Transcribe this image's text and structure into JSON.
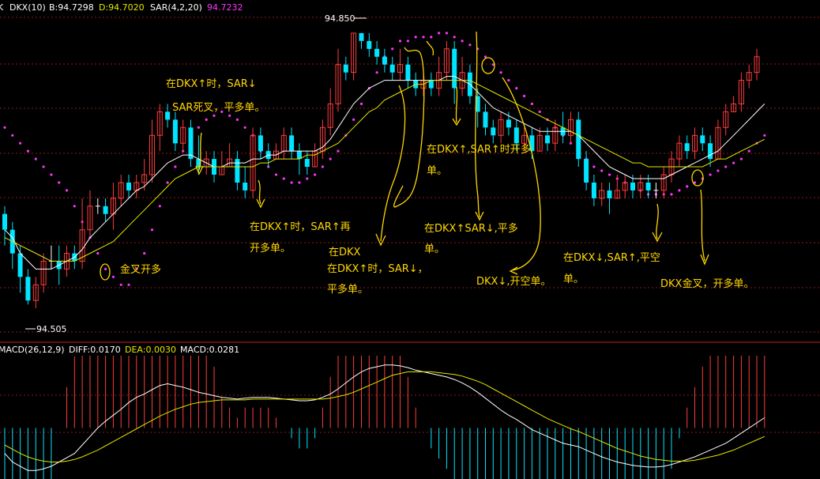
{
  "colors": {
    "background": "#000000",
    "up": "#ff3b3b",
    "down": "#00e5ff",
    "doji": "#ffffff",
    "grid": "#8b1a1a",
    "dkx": "#ffffff",
    "madkx": "#e6e600",
    "sar": "#ff33ff",
    "annotation": "#ffd700",
    "diff": "#ffffff",
    "dea": "#e6e600"
  },
  "header": {
    "prefix": "K",
    "dkx_label": "DKX(10)",
    "b_label": "B:94.7298",
    "d_label": "D:94.7020",
    "sar_label": "SAR(4,2,20)",
    "sar_value": "94.7232"
  },
  "price_marks": {
    "high": "94.850",
    "low": "94.505"
  },
  "macd_header": {
    "name": "MACD(26,12,9)",
    "diff": "DIFF:0.0170",
    "dea": "DEA:0.0030",
    "macd": "MACD:0.0281"
  },
  "annotations": {
    "a1_l1": "在DKX↑时，SAR↓",
    "a1_l2": "SAR死叉，平多单。",
    "a2": "金叉开多",
    "a3_l1": "在DKX↑时，SAR↑再",
    "a3_l2": "开多单。",
    "a4_l1": "在DKX",
    "a4_l2": "在DKX↑时，SAR↓，",
    "a4_l3": "平多单。",
    "a5_l1": "在DKX↑,SAR↑时开多",
    "a5_l2": "单。",
    "a6_l1": "在DKX↑SAR↓,平多",
    "a6_l2": "单。",
    "a7": "DKX↓,开空单。",
    "a8_l1": "在DKX↓,SAR↑,平空",
    "a8_l2": "单。",
    "a9": "DKX金叉，开多单。"
  },
  "chart_data": {
    "type": "candlestick",
    "price_range": [
      94.47,
      94.87
    ],
    "high_mark": 94.85,
    "low_mark": 94.505,
    "candles": [
      [
        94.62,
        94.6,
        94.63,
        94.58
      ],
      [
        94.6,
        94.57,
        94.61,
        94.55
      ],
      [
        94.57,
        94.54,
        94.58,
        94.52
      ],
      [
        94.54,
        94.51,
        94.55,
        94.505
      ],
      [
        94.51,
        94.53,
        94.54,
        94.5
      ],
      [
        94.53,
        94.56,
        94.57,
        94.52
      ],
      [
        94.56,
        94.56,
        94.58,
        94.55
      ],
      [
        94.56,
        94.55,
        94.58,
        94.53
      ],
      [
        94.55,
        94.57,
        94.58,
        94.54
      ],
      [
        94.57,
        94.56,
        94.58,
        94.55
      ],
      [
        94.56,
        94.6,
        94.64,
        94.55
      ],
      [
        94.6,
        94.63,
        94.65,
        94.59
      ],
      [
        94.63,
        94.63,
        94.64,
        94.62
      ],
      [
        94.63,
        94.62,
        94.64,
        94.61
      ],
      [
        94.62,
        94.64,
        94.66,
        94.6
      ],
      [
        94.64,
        94.66,
        94.67,
        94.63
      ],
      [
        94.66,
        94.65,
        94.67,
        94.64
      ],
      [
        94.65,
        94.66,
        94.67,
        94.64
      ],
      [
        94.66,
        94.67,
        94.69,
        94.65
      ],
      [
        94.67,
        94.72,
        94.74,
        94.66
      ],
      [
        94.72,
        94.75,
        94.76,
        94.7
      ],
      [
        94.75,
        94.74,
        94.76,
        94.73
      ],
      [
        94.74,
        94.71,
        94.75,
        94.7
      ],
      [
        94.71,
        94.73,
        94.74,
        94.7
      ],
      [
        94.73,
        94.69,
        94.74,
        94.68
      ],
      [
        94.69,
        94.68,
        94.72,
        94.67
      ],
      [
        94.68,
        94.69,
        94.7,
        94.67
      ],
      [
        94.69,
        94.67,
        94.7,
        94.66
      ],
      [
        94.67,
        94.68,
        94.7,
        94.67
      ],
      [
        94.68,
        94.69,
        94.71,
        94.68
      ],
      [
        94.69,
        94.66,
        94.7,
        94.65
      ],
      [
        94.66,
        94.65,
        94.68,
        94.64
      ],
      [
        94.65,
        94.72,
        94.73,
        94.64
      ],
      [
        94.72,
        94.7,
        94.73,
        94.69
      ],
      [
        94.7,
        94.69,
        94.71,
        94.68
      ],
      [
        94.69,
        94.7,
        94.71,
        94.69
      ],
      [
        94.7,
        94.72,
        94.73,
        94.69
      ],
      [
        94.72,
        94.7,
        94.73,
        94.69
      ],
      [
        94.7,
        94.69,
        94.71,
        94.67
      ],
      [
        94.69,
        94.68,
        94.7,
        94.67
      ],
      [
        94.68,
        94.7,
        94.71,
        94.68
      ],
      [
        94.7,
        94.73,
        94.74,
        94.69
      ],
      [
        94.73,
        94.76,
        94.78,
        94.72
      ],
      [
        94.76,
        94.81,
        94.83,
        94.75
      ],
      [
        94.81,
        94.8,
        94.82,
        94.79
      ],
      [
        94.8,
        94.85,
        94.85,
        94.79
      ],
      [
        94.85,
        94.84,
        94.85,
        94.83
      ],
      [
        94.84,
        94.83,
        94.85,
        94.82
      ],
      [
        94.83,
        94.82,
        94.84,
        94.81
      ],
      [
        94.82,
        94.81,
        94.83,
        94.8
      ],
      [
        94.81,
        94.8,
        94.82,
        94.79
      ],
      [
        94.8,
        94.81,
        94.83,
        94.79
      ],
      [
        94.81,
        94.79,
        94.82,
        94.78
      ],
      [
        94.79,
        94.78,
        94.8,
        94.77
      ],
      [
        94.78,
        94.79,
        94.8,
        94.77
      ],
      [
        94.79,
        94.78,
        94.8,
        94.77
      ],
      [
        94.78,
        94.8,
        94.82,
        94.77
      ],
      [
        94.8,
        94.83,
        94.84,
        94.79
      ],
      [
        94.83,
        94.78,
        94.84,
        94.76
      ],
      [
        94.78,
        94.8,
        94.82,
        94.77
      ],
      [
        94.8,
        94.77,
        94.81,
        94.76
      ],
      [
        94.77,
        94.75,
        94.78,
        94.73
      ],
      [
        94.75,
        94.73,
        94.76,
        94.72
      ],
      [
        94.73,
        94.72,
        94.74,
        94.71
      ],
      [
        94.72,
        94.74,
        94.75,
        94.71
      ],
      [
        94.74,
        94.73,
        94.75,
        94.72
      ],
      [
        94.73,
        94.71,
        94.74,
        94.7
      ],
      [
        94.71,
        94.72,
        94.73,
        94.7
      ],
      [
        94.72,
        94.7,
        94.73,
        94.69
      ],
      [
        94.7,
        94.72,
        94.73,
        94.7
      ],
      [
        94.72,
        94.71,
        94.73,
        94.7
      ],
      [
        94.71,
        94.73,
        94.74,
        94.7
      ],
      [
        94.73,
        94.72,
        94.75,
        94.71
      ],
      [
        94.72,
        94.74,
        94.75,
        94.71
      ],
      [
        94.74,
        94.69,
        94.75,
        94.68
      ],
      [
        94.69,
        94.66,
        94.7,
        94.65
      ],
      [
        94.66,
        94.64,
        94.67,
        94.63
      ],
      [
        94.64,
        94.65,
        94.66,
        94.63
      ],
      [
        94.65,
        94.64,
        94.66,
        94.62
      ],
      [
        94.64,
        94.65,
        94.67,
        94.64
      ],
      [
        94.65,
        94.66,
        94.67,
        94.64
      ],
      [
        94.66,
        94.65,
        94.67,
        94.64
      ],
      [
        94.65,
        94.66,
        94.67,
        94.64
      ],
      [
        94.66,
        94.65,
        94.67,
        94.64
      ],
      [
        94.65,
        94.65,
        94.66,
        94.64
      ],
      [
        94.65,
        94.67,
        94.68,
        94.64
      ],
      [
        94.67,
        94.69,
        94.7,
        94.66
      ],
      [
        94.69,
        94.71,
        94.72,
        94.68
      ],
      [
        94.71,
        94.7,
        94.72,
        94.69
      ],
      [
        94.7,
        94.72,
        94.73,
        94.69
      ],
      [
        94.72,
        94.71,
        94.73,
        94.7
      ],
      [
        94.71,
        94.69,
        94.72,
        94.68
      ],
      [
        94.69,
        94.73,
        94.74,
        94.69
      ],
      [
        94.73,
        94.75,
        94.76,
        94.72
      ],
      [
        94.75,
        94.76,
        94.77,
        94.75
      ],
      [
        94.76,
        94.79,
        94.8,
        94.75
      ],
      [
        94.79,
        94.8,
        94.81,
        94.78
      ],
      [
        94.8,
        94.82,
        94.83,
        94.79
      ]
    ],
    "dkx": [
      94.6,
      94.59,
      94.57,
      94.56,
      94.55,
      94.55,
      94.55,
      94.555,
      94.56,
      94.565,
      94.575,
      94.59,
      94.6,
      94.61,
      94.62,
      94.63,
      94.64,
      94.65,
      94.655,
      94.665,
      94.675,
      94.685,
      94.69,
      94.695,
      94.695,
      94.69,
      94.685,
      94.68,
      94.68,
      94.685,
      94.685,
      94.685,
      94.69,
      94.69,
      94.695,
      94.695,
      94.7,
      94.7,
      94.7,
      94.7,
      94.7,
      94.705,
      94.715,
      94.73,
      94.745,
      94.76,
      94.77,
      94.78,
      94.785,
      94.79,
      94.79,
      94.79,
      94.79,
      94.79,
      94.79,
      94.79,
      94.79,
      94.795,
      94.795,
      94.79,
      94.785,
      94.775,
      94.765,
      94.755,
      94.75,
      94.745,
      94.74,
      94.735,
      94.73,
      94.725,
      94.725,
      94.725,
      94.725,
      94.725,
      94.72,
      94.71,
      94.7,
      94.69,
      94.68,
      94.675,
      94.67,
      94.665,
      94.665,
      94.665,
      94.665,
      94.665,
      94.67,
      94.675,
      94.68,
      94.685,
      94.69,
      94.695,
      94.7,
      94.71,
      94.72,
      94.73,
      94.74,
      94.75,
      94.76
    ],
    "madkx": [
      94.59,
      94.585,
      94.58,
      94.575,
      94.57,
      94.565,
      94.56,
      94.56,
      94.56,
      94.56,
      94.565,
      94.57,
      94.575,
      94.58,
      94.585,
      94.595,
      94.605,
      94.615,
      94.625,
      94.635,
      94.645,
      94.655,
      94.665,
      94.67,
      94.675,
      94.68,
      94.68,
      94.68,
      94.68,
      94.68,
      94.68,
      94.68,
      94.68,
      94.685,
      94.685,
      94.69,
      94.69,
      94.69,
      94.69,
      94.695,
      94.695,
      94.7,
      94.705,
      94.71,
      94.72,
      94.73,
      94.74,
      94.75,
      94.755,
      94.765,
      94.77,
      94.775,
      94.78,
      94.785,
      94.785,
      94.79,
      94.79,
      94.79,
      94.79,
      94.79,
      94.79,
      94.785,
      94.78,
      94.775,
      94.77,
      94.765,
      94.76,
      94.755,
      94.75,
      94.745,
      94.74,
      94.735,
      94.73,
      94.725,
      94.72,
      94.715,
      94.71,
      94.705,
      94.7,
      94.695,
      94.69,
      94.685,
      94.685,
      94.68,
      94.68,
      94.68,
      94.68,
      94.68,
      94.68,
      94.68,
      94.68,
      94.685,
      94.69,
      94.69,
      94.695,
      94.7,
      94.705,
      94.71,
      94.715
    ],
    "sar": [
      94.73,
      94.72,
      94.71,
      94.7,
      94.69,
      94.68,
      94.67,
      94.66,
      94.65,
      94.63,
      94.61,
      94.59,
      94.57,
      94.55,
      94.54,
      94.53,
      94.53,
      94.55,
      94.57,
      94.6,
      94.63,
      94.66,
      94.68,
      94.7,
      94.72,
      94.73,
      94.74,
      94.745,
      94.75,
      94.745,
      94.74,
      94.73,
      94.72,
      94.7,
      94.68,
      94.67,
      94.665,
      94.66,
      94.66,
      94.665,
      94.67,
      94.68,
      94.69,
      94.7,
      94.72,
      94.74,
      94.76,
      94.78,
      94.8,
      94.82,
      94.83,
      94.84,
      94.84,
      94.845,
      94.845,
      94.845,
      94.85,
      94.85,
      94.845,
      94.84,
      94.835,
      94.83,
      94.82,
      94.81,
      94.8,
      94.79,
      94.78,
      94.77,
      94.76,
      94.75,
      94.74,
      94.73,
      94.72,
      94.71,
      94.7,
      94.69,
      94.68,
      94.675,
      94.67,
      94.665,
      94.66,
      94.655,
      94.65,
      94.645,
      94.645,
      94.645,
      94.645,
      94.65,
      94.655,
      94.66,
      94.665,
      94.67,
      94.675,
      94.68,
      94.685,
      94.69,
      94.7,
      94.71,
      94.72
    ],
    "diff": [
      -0.03,
      -0.04,
      -0.045,
      -0.05,
      -0.05,
      -0.048,
      -0.045,
      -0.04,
      -0.035,
      -0.03,
      -0.02,
      -0.01,
      0.0,
      0.008,
      0.015,
      0.022,
      0.03,
      0.036,
      0.04,
      0.045,
      0.05,
      0.052,
      0.05,
      0.048,
      0.045,
      0.042,
      0.04,
      0.038,
      0.036,
      0.035,
      0.034,
      0.035,
      0.036,
      0.036,
      0.036,
      0.035,
      0.034,
      0.033,
      0.032,
      0.032,
      0.033,
      0.036,
      0.04,
      0.046,
      0.053,
      0.06,
      0.066,
      0.07,
      0.072,
      0.074,
      0.074,
      0.073,
      0.071,
      0.068,
      0.066,
      0.064,
      0.062,
      0.06,
      0.057,
      0.053,
      0.048,
      0.042,
      0.035,
      0.028,
      0.021,
      0.015,
      0.01,
      0.004,
      -0.002,
      -0.006,
      -0.01,
      -0.014,
      -0.018,
      -0.02,
      -0.022,
      -0.026,
      -0.03,
      -0.034,
      -0.037,
      -0.04,
      -0.042,
      -0.044,
      -0.045,
      -0.046,
      -0.046,
      -0.045,
      -0.043,
      -0.04,
      -0.037,
      -0.034,
      -0.03,
      -0.026,
      -0.022,
      -0.018,
      -0.012,
      -0.006,
      0.0,
      0.006,
      0.012
    ],
    "dea": [
      -0.02,
      -0.025,
      -0.03,
      -0.034,
      -0.037,
      -0.039,
      -0.04,
      -0.04,
      -0.039,
      -0.037,
      -0.034,
      -0.03,
      -0.026,
      -0.021,
      -0.016,
      -0.011,
      -0.006,
      -0.001,
      0.004,
      0.009,
      0.014,
      0.018,
      0.022,
      0.025,
      0.028,
      0.03,
      0.031,
      0.032,
      0.033,
      0.033,
      0.033,
      0.033,
      0.034,
      0.034,
      0.034,
      0.034,
      0.034,
      0.034,
      0.034,
      0.034,
      0.034,
      0.034,
      0.035,
      0.037,
      0.039,
      0.042,
      0.046,
      0.05,
      0.054,
      0.058,
      0.062,
      0.064,
      0.066,
      0.066,
      0.066,
      0.066,
      0.065,
      0.064,
      0.063,
      0.061,
      0.058,
      0.055,
      0.051,
      0.046,
      0.041,
      0.036,
      0.031,
      0.026,
      0.021,
      0.016,
      0.011,
      0.007,
      0.003,
      -0.001,
      -0.004,
      -0.008,
      -0.012,
      -0.016,
      -0.02,
      -0.024,
      -0.027,
      -0.03,
      -0.033,
      -0.035,
      -0.037,
      -0.038,
      -0.039,
      -0.039,
      -0.039,
      -0.038,
      -0.036,
      -0.034,
      -0.032,
      -0.029,
      -0.026,
      -0.022,
      -0.018,
      -0.014,
      -0.01
    ],
    "macd_range": [
      -0.06,
      0.085
    ]
  }
}
